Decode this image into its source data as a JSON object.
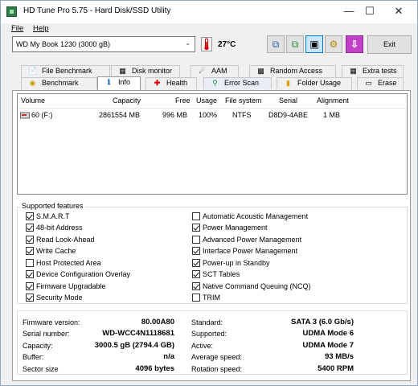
{
  "window": {
    "title": "HD Tune Pro 5.75 - Hard Disk/SSD Utility"
  },
  "menu": [
    {
      "label": "File"
    },
    {
      "label": "Help"
    }
  ],
  "toolbar": {
    "drive": "WD     My Book 1230 (3000 gB)",
    "temperature": "27°C",
    "exit_label": "Exit"
  },
  "tabs_row1": [
    {
      "label": "File Benchmark",
      "icon": "file-benchmark-icon"
    },
    {
      "label": "Disk monitor",
      "icon": "disk-monitor-icon"
    },
    {
      "label": "AAM",
      "icon": "speaker-icon"
    },
    {
      "label": "Random Access",
      "icon": "random-access-icon"
    },
    {
      "label": "Extra tests",
      "icon": "extra-tests-icon"
    }
  ],
  "tabs_row2": [
    {
      "label": "Benchmark",
      "icon": "benchmark-icon"
    },
    {
      "label": "Info",
      "icon": "info-icon"
    },
    {
      "label": "Health",
      "icon": "health-icon"
    },
    {
      "label": "Error Scan",
      "icon": "magnifier-icon"
    },
    {
      "label": "Folder Usage",
      "icon": "folder-icon"
    },
    {
      "label": "Erase",
      "icon": "trash-icon"
    }
  ],
  "volumes": {
    "columns": [
      "Volume",
      "Capacity",
      "Free",
      "Usage",
      "File system",
      "Serial",
      "Alignment"
    ],
    "rows": [
      {
        "volume": "60 (F:)",
        "capacity": "2861554 MB",
        "free": "996 MB",
        "usage": "100%",
        "fs": "NTFS",
        "serial": "D8D9-4ABE",
        "alignment": "1 MB"
      }
    ]
  },
  "features": {
    "title": "Supported features",
    "left": [
      {
        "label": "S.M.A.R.T",
        "checked": true
      },
      {
        "label": "48-bit Address",
        "checked": true
      },
      {
        "label": "Read Look-Ahead",
        "checked": true
      },
      {
        "label": "Write Cache",
        "checked": true
      },
      {
        "label": "Host Protected Area",
        "checked": false
      },
      {
        "label": "Device Configuration Overlay",
        "checked": true
      },
      {
        "label": "Firmware Upgradable",
        "checked": true
      },
      {
        "label": "Security Mode",
        "checked": true
      }
    ],
    "right": [
      {
        "label": "Automatic Acoustic Management",
        "checked": false
      },
      {
        "label": "Power Management",
        "checked": true
      },
      {
        "label": "Advanced Power Management",
        "checked": false
      },
      {
        "label": "Interface Power Management",
        "checked": true
      },
      {
        "label": "Power-up in Standby",
        "checked": true
      },
      {
        "label": "SCT Tables",
        "checked": true
      },
      {
        "label": "Native Command Queuing (NCQ)",
        "checked": true
      },
      {
        "label": "TRIM",
        "checked": false
      }
    ]
  },
  "info": {
    "left": [
      {
        "key": "Firmware version:",
        "value": "80.00A80"
      },
      {
        "key": "Serial number:",
        "value": "WD-WCC4N1118681"
      },
      {
        "key": "Capacity:",
        "value": "3000.5 gB (2794.4 GB)"
      },
      {
        "key": "Buffer:",
        "value": "n/a"
      },
      {
        "key": "Sector size",
        "value": "4096 bytes"
      }
    ],
    "right": [
      {
        "key": "Standard:",
        "value": "SATA 3 (6.0 Gb/s)"
      },
      {
        "key": "Supported:",
        "value": "UDMA Mode 6"
      },
      {
        "key": "Active:",
        "value": "UDMA Mode 7"
      },
      {
        "key": "Average speed:",
        "value": "93 MB/s"
      },
      {
        "key": "Rotation speed:",
        "value": "5400 RPM"
      }
    ]
  }
}
